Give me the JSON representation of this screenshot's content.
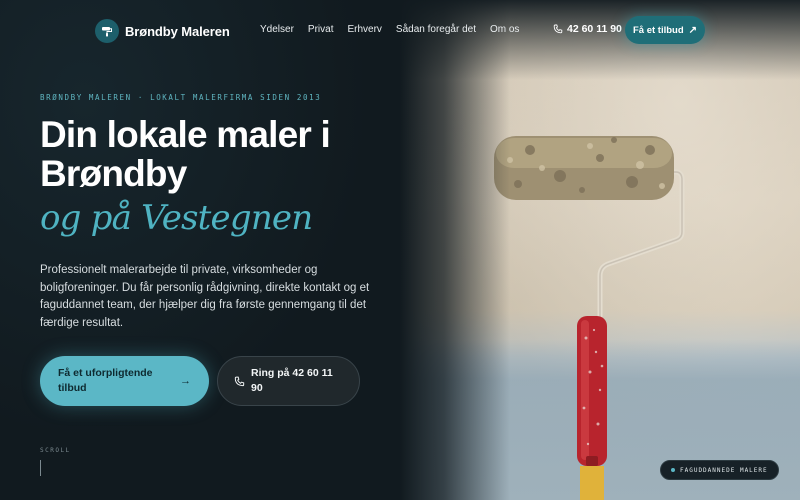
{
  "header": {
    "brand_name": "Brøndby Maleren",
    "nav": [
      "Ydelser",
      "Privat",
      "Erhverv",
      "Sådan foregår det",
      "Om os"
    ],
    "phone": "42 60 11 90",
    "cta_label": "Få et tilbud"
  },
  "hero": {
    "eyebrow": "BRØNDBY MALEREN · LOKALT MALERFIRMA SIDEN 2013",
    "headline": "Din lokale maler i Brøndby",
    "headline_accent": "og på Vestegnen",
    "lead": "Professionelt malerarbejde til private, virksomheder og boligforeninger. Du får personlig rådgivning, direkte kontakt og et faguddannet team, der hjælper dig fra første gennemgang til det færdige resultat.",
    "primary_button": "Få et uforpligtende tilbud",
    "secondary_button": "Ring på 42 60 11 90",
    "scroll_label": "SCROLL",
    "badge": "FAGUDDANNEDE MALERE"
  },
  "colors": {
    "background": "#111a1f",
    "accent": "#5bb7c6",
    "accent_dark": "#1f6e78"
  },
  "icons": {
    "logo": "paint-roller-logo-icon",
    "phone": "phone-icon",
    "arrow": "arrow-icon",
    "photo": "paint-roller-photo"
  }
}
